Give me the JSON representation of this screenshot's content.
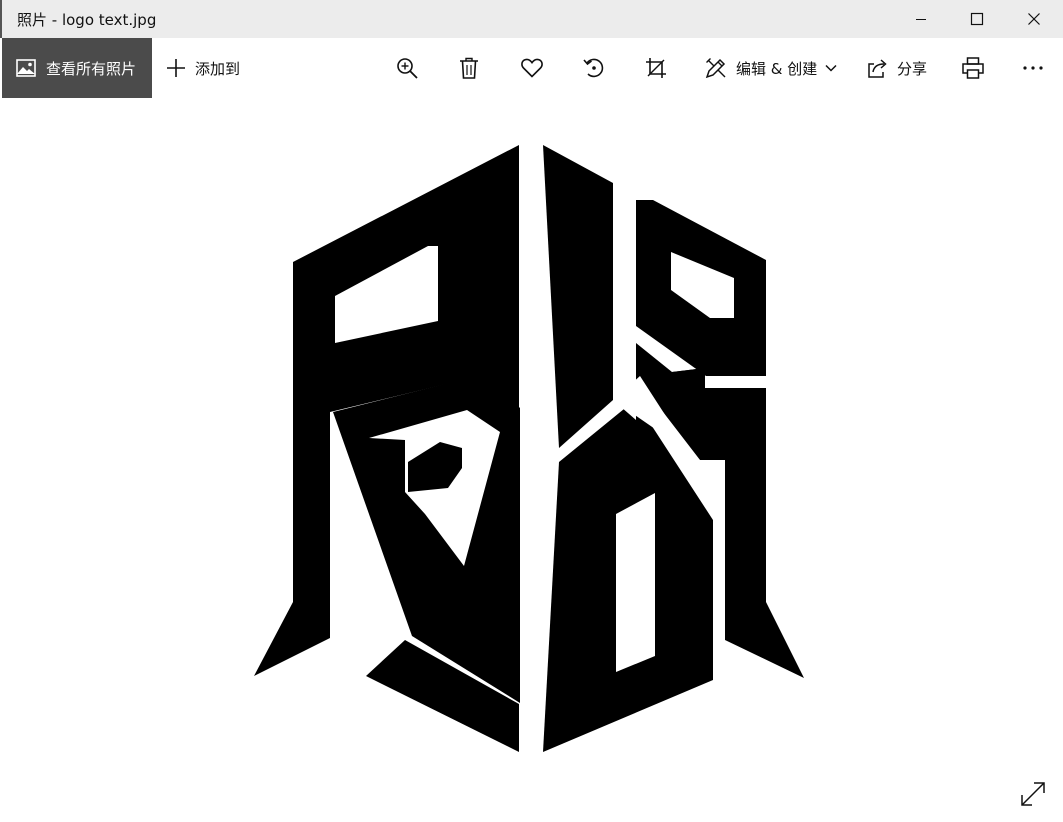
{
  "window": {
    "title": "照片 - logo text.jpg"
  },
  "toolbar": {
    "view_all_label": "查看所有照片",
    "add_to_label": "添加到",
    "edit_create_label": "编辑 & 创建",
    "share_label": "分享"
  },
  "icons": {
    "view_all": "photo-gallery-icon",
    "add": "plus-icon",
    "zoom": "zoom-in-icon",
    "delete": "trash-icon",
    "favorite": "heart-icon",
    "rotate": "rotate-icon",
    "crop": "crop-icon",
    "edit": "edit-create-icon",
    "share": "share-icon",
    "print": "printer-icon",
    "more": "more-icon",
    "fullscreen": "expand-icon"
  },
  "image": {
    "subject": "black geometric stylized logo on white background"
  }
}
